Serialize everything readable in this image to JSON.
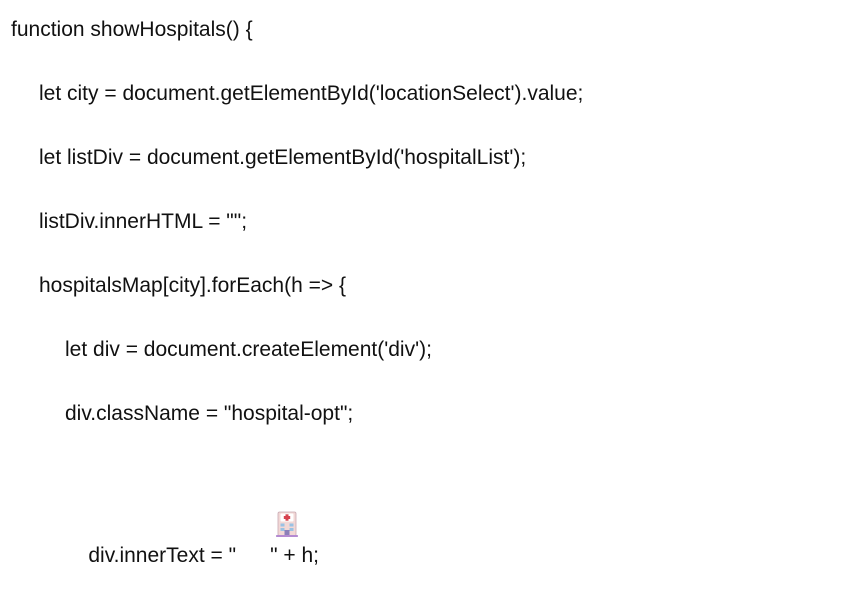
{
  "code": {
    "lines": [
      "function showHospitals() {",
      "let city = document.getElementById('locationSelect').value;",
      "let listDiv = document.getElementById('hospitalList');",
      "listDiv.innerHTML = \"\";",
      "hospitalsMap[city].forEach(h => {",
      "let div = document.createElement('div');",
      "div.className = \"hospital-opt\";"
    ],
    "last_line": {
      "before": "div.innerText = \"",
      "icon": "hospital-emoji-icon",
      "after": "\" + h;"
    }
  }
}
